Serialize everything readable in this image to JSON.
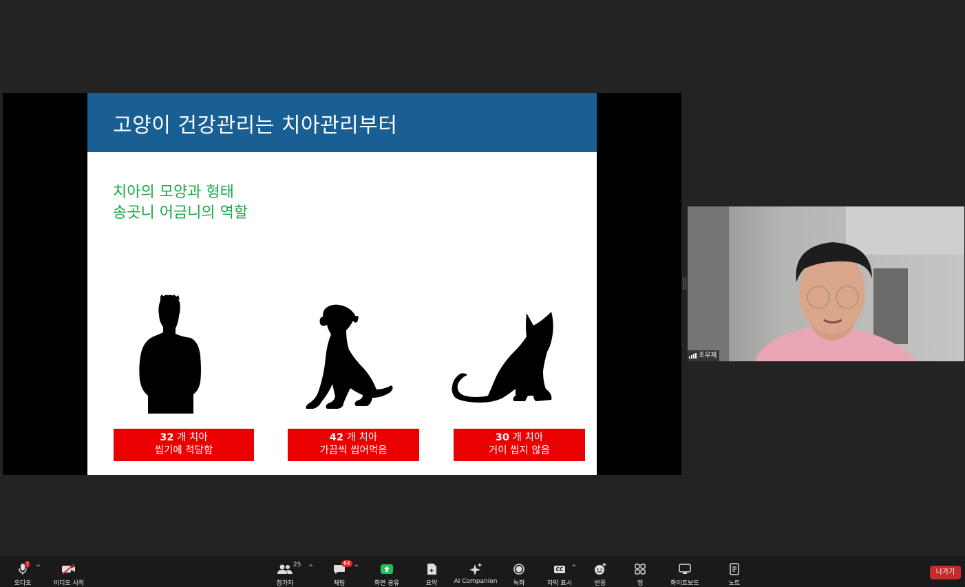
{
  "slide": {
    "title": "고양이 건강관리는 치아관리부터",
    "subtitle_lines": [
      "치아의 모양과 형태",
      "송곳니 어금니의 역할"
    ],
    "cards": [
      {
        "count": "32",
        "unit": " 개 치아",
        "desc": "씹기에 적당함"
      },
      {
        "count": "42",
        "unit": " 개 치아",
        "desc": "가끔씩 씹어먹음"
      },
      {
        "count": "30",
        "unit": " 개 치아",
        "desc": "거이 씹지 않음"
      }
    ],
    "colors": {
      "header": "#1a5f94",
      "subtitle": "#18a846",
      "card": "#ea0000"
    }
  },
  "participant": {
    "name": "조우재"
  },
  "toolbar": {
    "audio": {
      "label": "오디오",
      "icon": "microphone-icon",
      "badge": "!"
    },
    "video": {
      "label": "비디오 시작",
      "icon": "video-off-icon"
    },
    "participants": {
      "label": "참가자",
      "count": "25",
      "icon": "participants-icon"
    },
    "chat": {
      "label": "채팅",
      "badge": "64",
      "icon": "chat-icon"
    },
    "share": {
      "label": "화면 공유",
      "icon": "share-screen-icon"
    },
    "summary": {
      "label": "요약",
      "icon": "summary-icon"
    },
    "ai": {
      "label": "AI Companion",
      "icon": "ai-sparkle-icon"
    },
    "record": {
      "label": "녹화",
      "icon": "record-icon"
    },
    "captions": {
      "label": "자막 표시",
      "icon": "cc-icon",
      "icon_text": "CC"
    },
    "reactions": {
      "label": "반응",
      "icon": "reaction-icon"
    },
    "apps": {
      "label": "앱",
      "icon": "apps-icon"
    },
    "whiteboard": {
      "label": "화이트보드",
      "icon": "whiteboard-icon"
    },
    "notes": {
      "label": "노트",
      "icon": "notes-icon"
    },
    "leave": {
      "label": "나가기"
    }
  }
}
